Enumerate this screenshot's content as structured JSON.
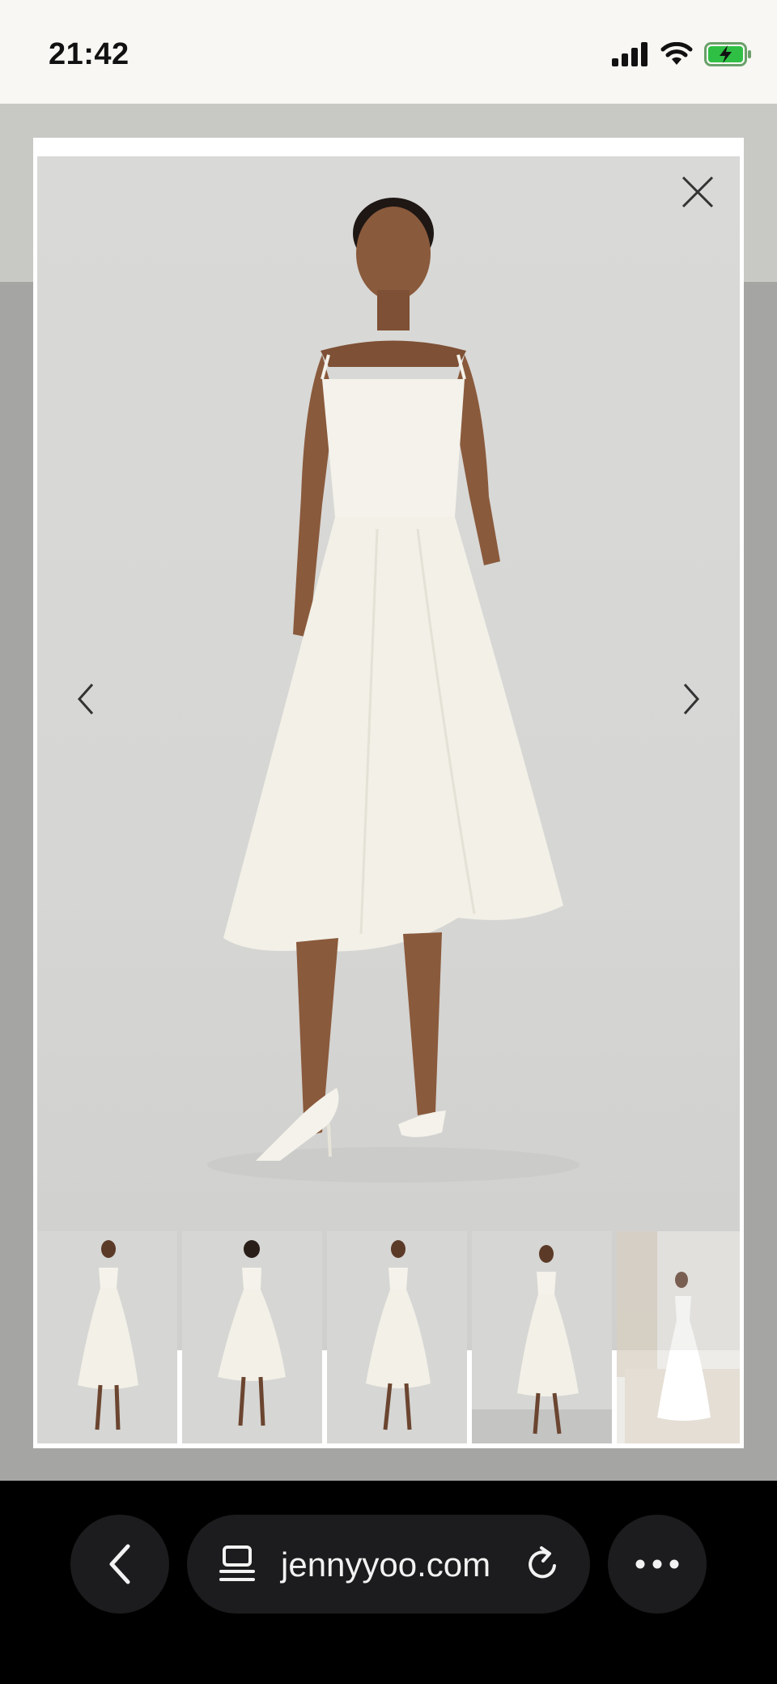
{
  "status_bar": {
    "time": "21:42",
    "icons": [
      "signal-icon",
      "wifi-icon",
      "battery-charging-icon"
    ]
  },
  "gallery": {
    "main_image": "white-midi-dress-front-image",
    "thumbnails": [
      {
        "icon": "dress-front-thumbnail"
      },
      {
        "icon": "dress-back-thumbnail"
      },
      {
        "icon": "dress-front-alt-thumbnail"
      },
      {
        "icon": "dress-side-thumbnail"
      },
      {
        "icon": "dress-lifestyle-thumbnail"
      }
    ]
  },
  "browser": {
    "url": "jennyyoo.com"
  },
  "colors": {
    "dress": "#f4f2ea",
    "skin": "#8a5a3c",
    "backdrop": "#d7d7d5",
    "battery": "#2fbf45"
  }
}
